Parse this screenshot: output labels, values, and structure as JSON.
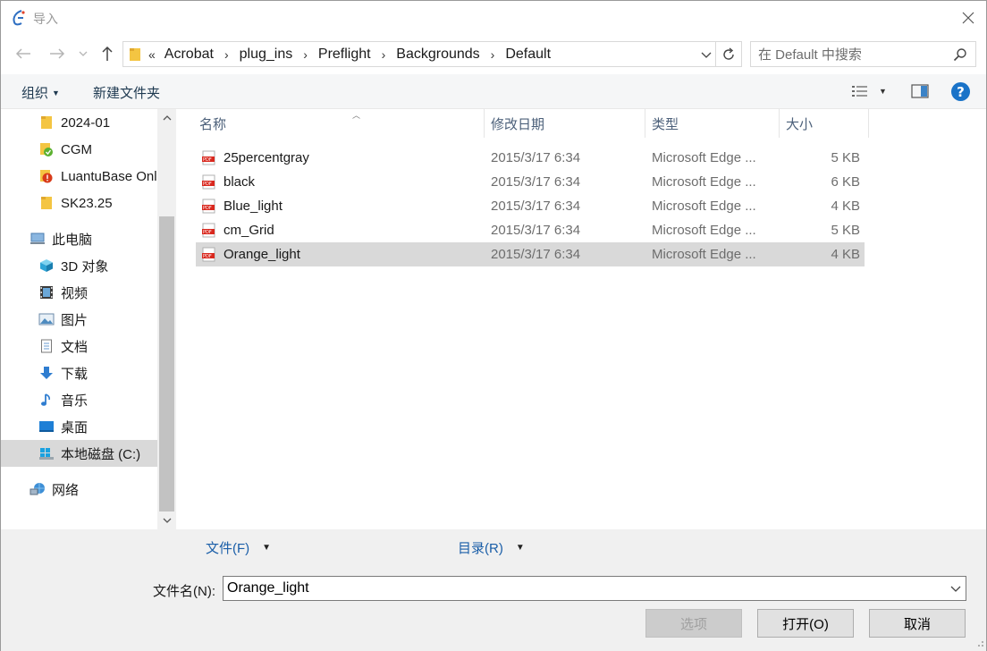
{
  "window": {
    "title": "导入"
  },
  "address": {
    "lead": "«",
    "segments": [
      "Acrobat",
      "plug_ins",
      "Preflight",
      "Backgrounds",
      "Default"
    ]
  },
  "search": {
    "placeholder": "在 Default 中搜索"
  },
  "toolbar": {
    "organize_label": "组织",
    "new_folder_label": "新建文件夹",
    "help_label": "?"
  },
  "nav": {
    "items": [
      {
        "label": "2024-01",
        "icon": "folder-icon"
      },
      {
        "label": "CGM",
        "icon": "folder-sync-icon"
      },
      {
        "label": "LuantuBase Onl",
        "icon": "folder-error-icon"
      },
      {
        "label": "SK23.25",
        "icon": "folder-icon"
      },
      {
        "label": "此电脑",
        "icon": "computer-icon"
      },
      {
        "label": "3D 对象",
        "icon": "cube-icon"
      },
      {
        "label": "视频",
        "icon": "video-icon"
      },
      {
        "label": "图片",
        "icon": "picture-icon"
      },
      {
        "label": "文档",
        "icon": "document-icon"
      },
      {
        "label": "下载",
        "icon": "download-icon"
      },
      {
        "label": "音乐",
        "icon": "music-icon"
      },
      {
        "label": "桌面",
        "icon": "desktop-icon"
      },
      {
        "label": "本地磁盘 (C:)",
        "icon": "drive-icon"
      },
      {
        "label": "网络",
        "icon": "network-icon"
      }
    ]
  },
  "columns": {
    "name": "名称",
    "date": "修改日期",
    "type": "类型",
    "size": "大小"
  },
  "files": [
    {
      "name": "25percentgray",
      "date": "2015/3/17 6:34",
      "type": "Microsoft Edge ...",
      "size": "5 KB"
    },
    {
      "name": "black",
      "date": "2015/3/17 6:34",
      "type": "Microsoft Edge ...",
      "size": "6 KB"
    },
    {
      "name": "Blue_light",
      "date": "2015/3/17 6:34",
      "type": "Microsoft Edge ...",
      "size": "4 KB"
    },
    {
      "name": "cm_Grid",
      "date": "2015/3/17 6:34",
      "type": "Microsoft Edge ...",
      "size": "5 KB"
    },
    {
      "name": "Orange_light",
      "date": "2015/3/17 6:34",
      "type": "Microsoft Edge ...",
      "size": "4 KB"
    }
  ],
  "bottom": {
    "file_menu": "文件(F)",
    "dir_menu": "目录(R)",
    "filename_label": "文件名(N):",
    "filename_value": "Orange_light",
    "options_button": "选项",
    "open_button": "打开(O)",
    "cancel_button": "取消"
  }
}
